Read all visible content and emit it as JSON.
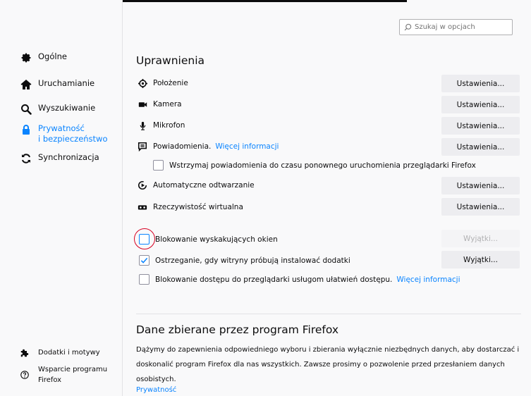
{
  "sidebar": {
    "items": [
      {
        "label": "Ogólne",
        "icon": "gear-icon"
      },
      {
        "label": "Uruchamianie",
        "icon": "home-icon"
      },
      {
        "label": "Wyszukiwanie",
        "icon": "search-icon"
      },
      {
        "label": "Prywatność",
        "label2": "i bezpieczeństwo",
        "icon": "lock-icon",
        "active": true
      },
      {
        "label": "Synchronizacja",
        "icon": "sync-icon"
      }
    ],
    "footer": [
      {
        "label": "Dodatki i motywy",
        "icon": "puzzle-icon"
      },
      {
        "label": "Wsparcie programu",
        "label2": "Firefox",
        "icon": "help-icon"
      }
    ]
  },
  "search": {
    "placeholder": "Szukaj w opcjach"
  },
  "permissions": {
    "title": "Uprawnienia",
    "rows": [
      {
        "label": "Położenie",
        "button": "Ustawienia..."
      },
      {
        "label": "Kamera",
        "button": "Ustawienia..."
      },
      {
        "label": "Mikrofon",
        "button": "Ustawienia..."
      },
      {
        "label": "Powiadomienia.",
        "link": "Więcej informacji",
        "button": "Ustawienia..."
      },
      {
        "label": "Automatyczne odtwarzanie",
        "button": "Ustawienia..."
      },
      {
        "label": "Rzeczywistość wirtualna",
        "button": "Ustawienia..."
      }
    ],
    "pause_notifications": "Wstrzymaj powiadomienia do czasu ponownego uruchomienia przeglądarki Firefox",
    "block_popups": {
      "label": "Blokowanie wyskakujących okien",
      "checked": false,
      "button": "Wyjątki..."
    },
    "warn_addons": {
      "label": "Ostrzeganie, gdy witryny próbują instalować dodatki",
      "checked": true,
      "button": "Wyjątki..."
    },
    "block_a11y": {
      "label": "Blokowanie dostępu do przeglądarki usługom ułatwień dostępu.",
      "link": "Więcej informacji",
      "checked": false
    }
  },
  "data_collection": {
    "title": "Dane zbierane przez program Firefox",
    "description": "Dążymy do zapewnienia odpowiedniego wyboru i zbierania wyłącznie niezbędnych danych, aby dostarczać i doskonalić program Firefox dla nas wszystkich. Zawsze prosimy o pozwolenie przed przesłaniem danych osobistych.",
    "link": "Prywatność"
  },
  "colors": {
    "accent": "#0a84ff",
    "highlight_circle": "#d70022"
  }
}
